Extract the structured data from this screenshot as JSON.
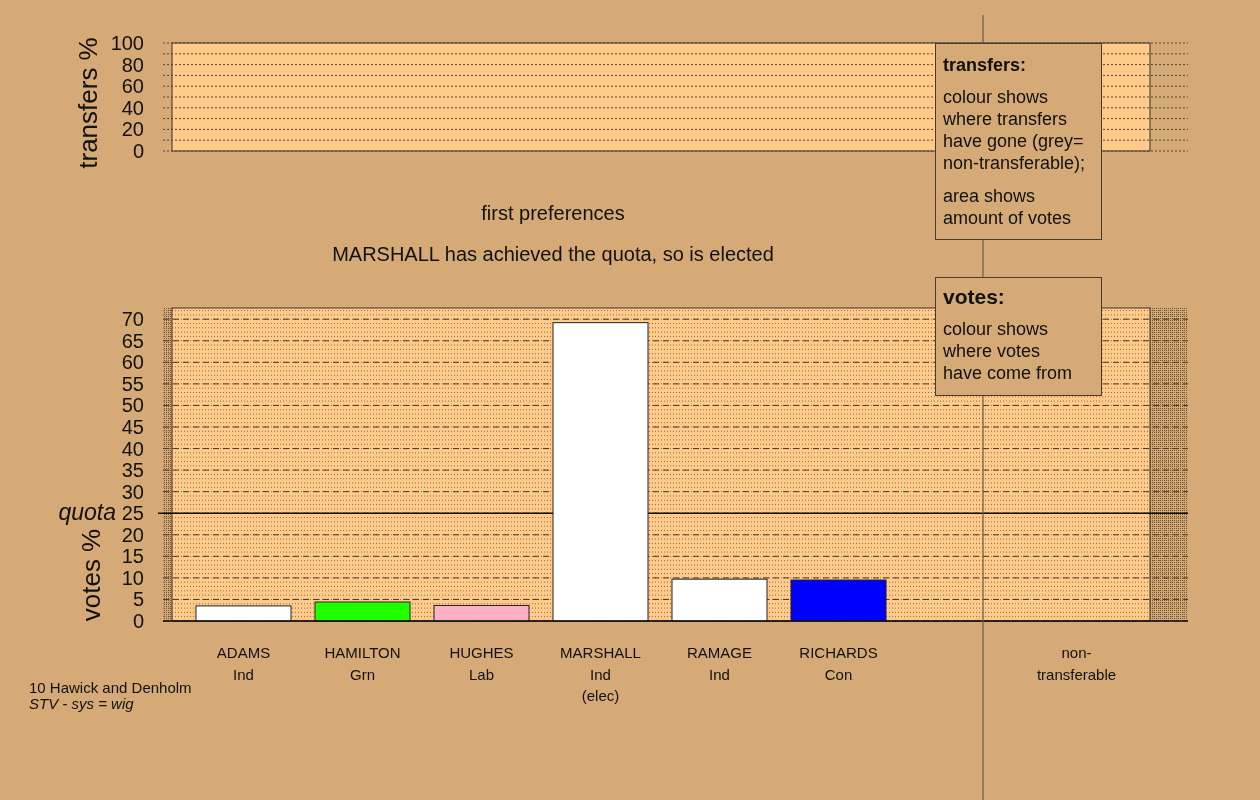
{
  "transfers_chart": {
    "chart_data": {
      "type": "bar",
      "ylabel": "transfers %",
      "categories": [
        null,
        null,
        null,
        null,
        null,
        null,
        null,
        null
      ],
      "values": [
        null,
        null,
        null,
        null,
        null,
        null,
        null,
        null
      ],
      "ylim": [
        0,
        100
      ],
      "yticks": [
        0,
        20,
        40,
        60,
        80,
        100
      ],
      "grid": true
    },
    "legend": {
      "title": "transfers:",
      "paragraphs": [
        "colour shows\nwhere transfers\nhave gone (grey=\nnon-transferable);",
        "area shows\namount of votes"
      ]
    }
  },
  "stage_title": "first preferences",
  "status_message": "MARSHALL has achieved the quota, so is elected",
  "votes_chart": {
    "chart_data": {
      "type": "bar",
      "ylabel": "votes %",
      "categories": [
        "ADAMS",
        "HAMILTON",
        "HUGHES",
        "MARSHALL",
        "RAMAGE",
        "RICHARDS",
        null,
        "non-transferable"
      ],
      "values": [
        3.5,
        4.4,
        3.6,
        69.2,
        9.7,
        9.5,
        null,
        null
      ],
      "ylim": [
        0,
        72.6
      ],
      "yticks": [
        0,
        5,
        10,
        15,
        20,
        25,
        30,
        35,
        40,
        45,
        50,
        55,
        60,
        65,
        70
      ],
      "grid": true,
      "ref_lines": [
        {
          "axis": "y",
          "value": 25,
          "label": "quota"
        }
      ]
    },
    "candidates": [
      {
        "party": "Ind",
        "color": "#ffffff"
      },
      {
        "party": "Grn",
        "color": "#22ff00"
      },
      {
        "party": "Lab",
        "color": "#ffb0c6"
      },
      {
        "party": "Ind",
        "note": "(elec)",
        "color": "#ffffff"
      },
      {
        "party": "Ind",
        "color": "#ffffff"
      },
      {
        "party": "Con",
        "color": "#0000ff"
      }
    ],
    "legend": {
      "title": "votes:",
      "paragraphs": [
        "colour shows\nwhere votes\nhave come from"
      ]
    }
  },
  "footer": {
    "constituency": "10 Hawick and Denholm",
    "system": "STV - sys = wig"
  }
}
